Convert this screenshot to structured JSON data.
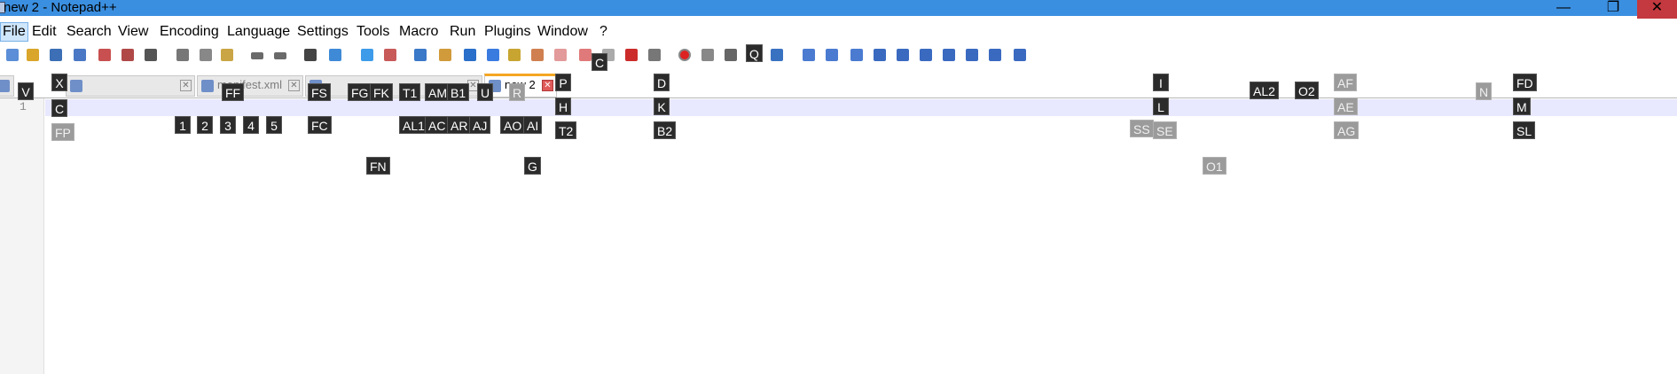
{
  "window": {
    "title": "new 2 - Notepad++",
    "minimize": "—",
    "maximize": "❐",
    "close": "✕"
  },
  "menu": [
    "File",
    "Edit",
    "Search",
    "View",
    "Encoding",
    "Language",
    "Settings",
    "Tools",
    "Macro",
    "Run",
    "Plugins",
    "Window",
    "?"
  ],
  "toolbar_icons": [
    "new-file-icon",
    "open-file-icon",
    "save-icon",
    "save-all-icon",
    "close-icon",
    "close-all-icon",
    "print-icon",
    "cut-icon",
    "copy-icon",
    "paste-icon",
    "undo-icon",
    "redo-icon",
    "find-icon",
    "replace-icon",
    "zoom-in-icon",
    "zoom-out-icon",
    "sync-vertical-icon",
    "sync-horizontal-icon",
    "word-wrap-icon",
    "show-all-chars-icon",
    "indent-guide-icon",
    "doc-map-icon",
    "function-list-icon",
    "folder-workspace-icon",
    "doc-icon",
    "folder-icon",
    "monitor-icon",
    "record-macro-icon",
    "stop-macro-icon",
    "play-macro-icon",
    "play-multiple-icon",
    "save-macro-icon",
    "run-icon",
    "show-doc-icon",
    "compare-icon",
    "compare-next-icon",
    "compare-prev-icon",
    "first-diff-icon",
    "prev-diff-icon",
    "next-diff-icon",
    "last-diff-icon",
    "panel-icon"
  ],
  "tabs": [
    {
      "label": "",
      "active": false
    },
    {
      "label": "manifest.xml",
      "active": false
    },
    {
      "label": "",
      "active": false
    },
    {
      "label": "new 2",
      "active": true
    }
  ],
  "editor": {
    "line_number": "1"
  },
  "hints": [
    {
      "label": "V",
      "dim": false
    },
    {
      "label": "X",
      "dim": false
    },
    {
      "label": "C",
      "dim": false
    },
    {
      "label": "FP",
      "dim": true
    },
    {
      "label": "FF",
      "dim": false
    },
    {
      "label": "FS",
      "dim": false
    },
    {
      "label": "FC",
      "dim": false
    },
    {
      "label": "FG",
      "dim": false
    },
    {
      "label": "FK",
      "dim": false
    },
    {
      "label": "FN",
      "dim": false
    },
    {
      "label": "T1",
      "dim": false
    },
    {
      "label": "AM",
      "dim": false
    },
    {
      "label": "B1",
      "dim": false
    },
    {
      "label": "U",
      "dim": false
    },
    {
      "label": "R",
      "dim": true
    },
    {
      "label": "P",
      "dim": false
    },
    {
      "label": "H",
      "dim": false
    },
    {
      "label": "T2",
      "dim": false
    },
    {
      "label": "G",
      "dim": false
    },
    {
      "label": "AL1",
      "dim": false
    },
    {
      "label": "AC",
      "dim": false
    },
    {
      "label": "AR",
      "dim": false
    },
    {
      "label": "AJ",
      "dim": false
    },
    {
      "label": "AO",
      "dim": false
    },
    {
      "label": "AI",
      "dim": false
    },
    {
      "label": "1",
      "dim": false
    },
    {
      "label": "2",
      "dim": false
    },
    {
      "label": "3",
      "dim": false
    },
    {
      "label": "4",
      "dim": false
    },
    {
      "label": "5",
      "dim": false
    },
    {
      "label": "C",
      "dim": false
    },
    {
      "label": "D",
      "dim": false
    },
    {
      "label": "K",
      "dim": false
    },
    {
      "label": "B2",
      "dim": false
    },
    {
      "label": "Q",
      "dim": false
    },
    {
      "label": "I",
      "dim": false
    },
    {
      "label": "L",
      "dim": false
    },
    {
      "label": "SS",
      "dim": true
    },
    {
      "label": "SE",
      "dim": true
    },
    {
      "label": "O1",
      "dim": true
    },
    {
      "label": "AL2",
      "dim": false
    },
    {
      "label": "O2",
      "dim": false
    },
    {
      "label": "AF",
      "dim": true
    },
    {
      "label": "AE",
      "dim": true
    },
    {
      "label": "AG",
      "dim": true
    },
    {
      "label": "N",
      "dim": true
    },
    {
      "label": "FD",
      "dim": false
    },
    {
      "label": "M",
      "dim": false
    },
    {
      "label": "SL",
      "dim": false
    }
  ]
}
